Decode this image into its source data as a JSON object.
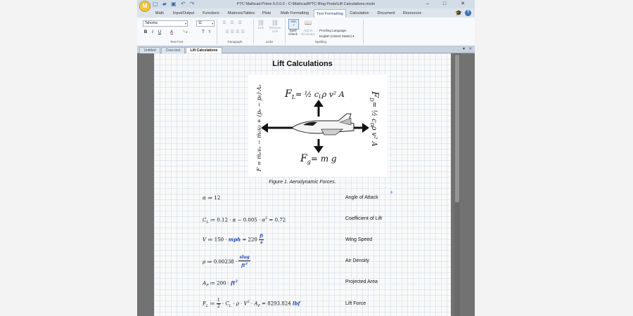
{
  "window": {
    "title": "PTC Mathcad Prime 6.0.0.0 - C:\\Mathcad\\PTC Blog Posts\\Lift Calculations.mcdx",
    "logo": "M",
    "controls": {
      "minimize": "–",
      "maximize": "□",
      "close": "✕"
    }
  },
  "quick_access": {
    "icons": [
      "new-icon",
      "open-icon",
      "save-icon",
      "undo-icon",
      "redo-icon"
    ],
    "glyphs": "▢ ▰ ▣ ↶ ↷"
  },
  "ribbon": {
    "tabs": [
      "Math",
      "Input/Output",
      "Functions",
      "Matrices/Tables",
      "Plots",
      "Math Formatting",
      "Text Formatting",
      "Calculation",
      "Document",
      "Resources"
    ],
    "active_tab": "Text Formatting",
    "font_group": {
      "font": "Tahoma",
      "size": "11",
      "label": "Text Font",
      "bold": "B",
      "italic": "I",
      "underline": "U",
      "font_color": "A",
      "highlight": "▾",
      "grow": "T",
      "shrink": "T"
    },
    "paragraph_group": {
      "label": "Paragraph"
    },
    "links_group": {
      "label": "Links",
      "link": "Link",
      "remove_link_1": "Remove",
      "remove_link_2": "Link"
    },
    "spelling_group": {
      "label": "Spelling",
      "spell_check_1": "Spell",
      "spell_check_2": "Check",
      "spell_icon_text": "ABC",
      "add_to_dictionary_1": "Add to",
      "add_to_dictionary_2": "Dictionary",
      "proofing_label": "Proofing Language:",
      "proofing_value": "English (United States)"
    }
  },
  "document_tabs": [
    "Untitled",
    "Creo-test",
    "Lift Calculations"
  ],
  "active_document": "Lift Calculations",
  "document": {
    "title": "Lift Calculations",
    "figure": {
      "caption": "Figure 1. Aerodynamic Forces.",
      "lift_label": "F",
      "lift_sub": "L",
      "lift_eq": "= ½ c",
      "lift_rest": "ρ v² A",
      "drag_label": "F",
      "drag_sub": "D",
      "drag_eq": "= ½ c",
      "drag_rest": "ρ v² A",
      "thrust_text": "F = ṁₑvₑ − ṁ₀v₀ + (pₑ − p₀)·Aₑ",
      "weight_label": "F",
      "weight_sub": "g",
      "weight_eq": "= m g"
    },
    "equations": [
      {
        "label": "Angle of Attack"
      },
      {
        "label": "Coefficient of Lift"
      },
      {
        "label": "Wing Speed"
      },
      {
        "label": "Air Density"
      },
      {
        "label": "Projected Area"
      },
      {
        "label": "Lift Force"
      }
    ]
  }
}
